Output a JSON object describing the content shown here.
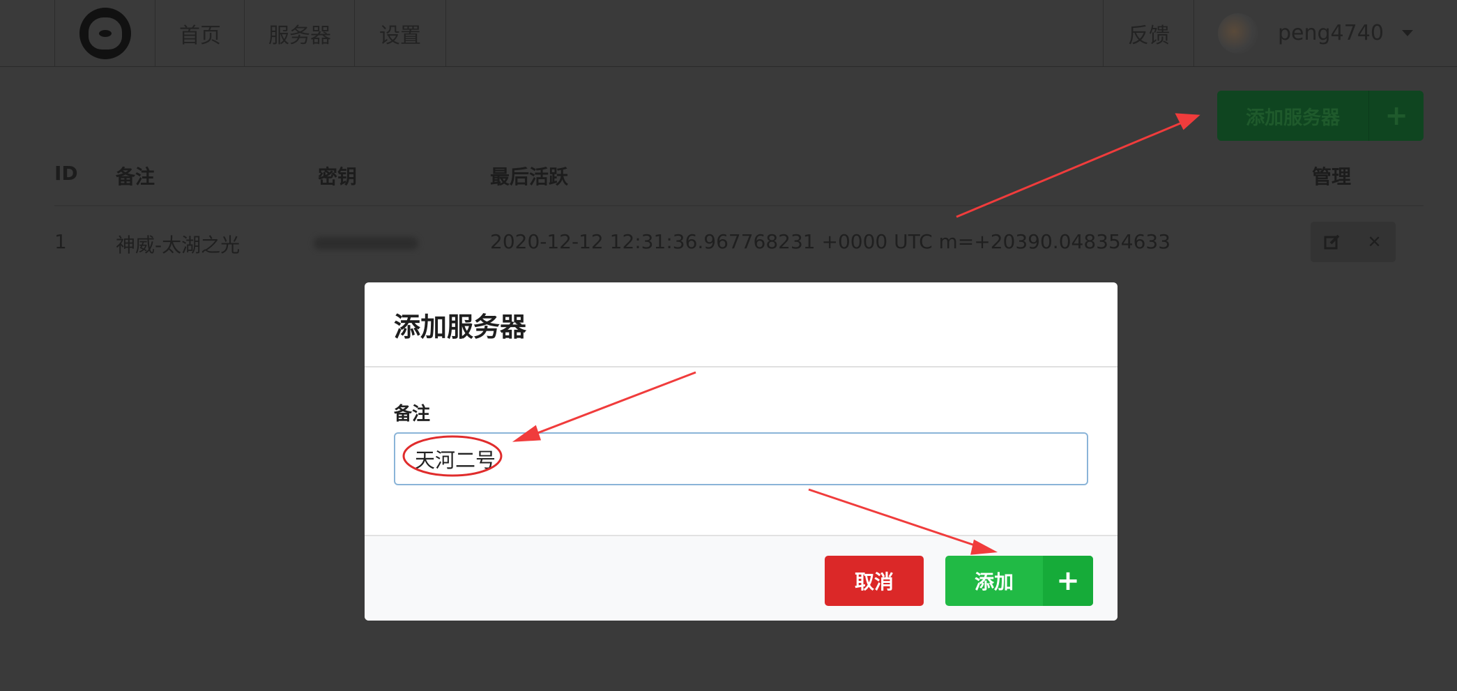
{
  "nav": {
    "home": "首页",
    "servers": "服务器",
    "settings": "设置",
    "feedback": "反馈",
    "user_name": "peng4740"
  },
  "toolbar": {
    "add_server_label": "添加服务器",
    "add_server_icon": "plus-icon"
  },
  "table": {
    "headers": [
      "ID",
      "备注",
      "密钥",
      "最后活跃",
      "管理"
    ],
    "rows": [
      {
        "id": "1",
        "note": "神威-太湖之光",
        "last_active": "2020-12-12 12:31:36.967768231 +0000 UTC m=+20390.048354633",
        "actions": [
          "edit-icon",
          "close-icon"
        ]
      }
    ]
  },
  "modal": {
    "title": "添加服务器",
    "field_label": "备注",
    "field_value": "天河二号",
    "cancel_label": "取消",
    "add_label": "添加",
    "add_icon": "plus-icon"
  },
  "colors": {
    "annotation_red": "#f03c3c",
    "cancel_red": "#db2828",
    "add_green": "#21ba45"
  }
}
